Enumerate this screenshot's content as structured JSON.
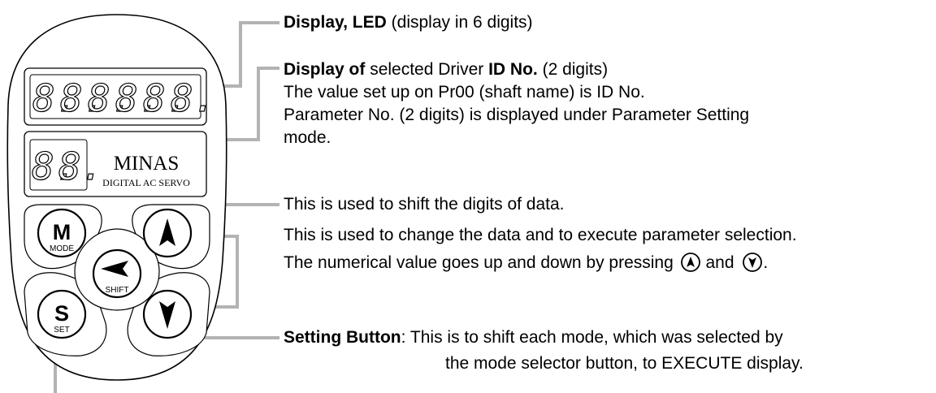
{
  "panel": {
    "brand": "MINAS",
    "subtitle": "DIGITAL AC SERVO",
    "seg_glyph": "8.",
    "buttons": {
      "mode": {
        "letter": "M",
        "caption": "MODE"
      },
      "shift": {
        "caption": "SHIFT"
      },
      "set": {
        "letter": "S",
        "caption": "SET"
      }
    }
  },
  "callouts": {
    "led": {
      "bold": "Display, LED",
      "rest": " (display in 6 digits)"
    },
    "id": {
      "bold1": "Display of",
      "mid": " selected Driver ",
      "bold2": "ID No.",
      "rest": " (2 digits)",
      "line2": "The value set up on Pr00 (shaft name) is ID No.",
      "line3": "Parameter No. (2 digits) is displayed under  Parameter Setting",
      "line4": "mode."
    },
    "shift": {
      "text": "This is used to shift the digits of data."
    },
    "updown": {
      "line1": "This is used to change the data and to execute parameter selection.",
      "line2_a": "The numerical value goes up and down by pressing",
      "line2_b": " and",
      "line2_c": "."
    },
    "set": {
      "bold": "Setting Button",
      "rest": ": This is to shift each mode, which was selected by",
      "line2": "the mode selector button, to  EXECUTE  display."
    }
  }
}
